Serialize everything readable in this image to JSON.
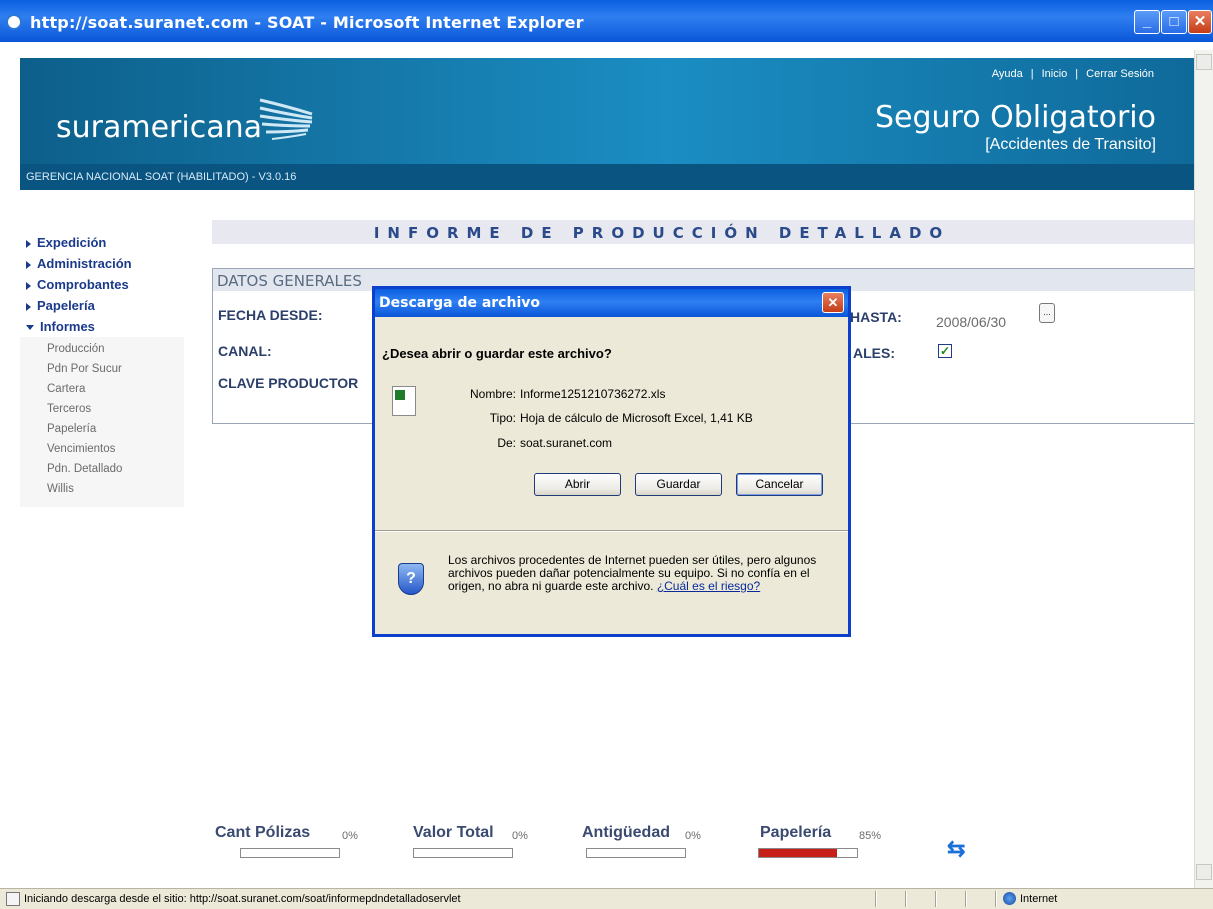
{
  "window": {
    "title": "http://soat.suranet.com - SOAT - Microsoft Internet Explorer"
  },
  "header": {
    "logo": "suramericana",
    "links": [
      "Ayuda",
      "Inicio",
      "Cerrar Sesión"
    ],
    "link_separator": "|",
    "brand_title": "Seguro Obligatorio",
    "brand_subtitle": "[Accidentes de Transito]",
    "subbar": "GERENCIA NACIONAL SOAT (HABILITADO) - V3.0.16"
  },
  "sidebar": {
    "items": [
      {
        "label": "Expedición"
      },
      {
        "label": "Administración"
      },
      {
        "label": "Comprobantes"
      },
      {
        "label": "Papelería"
      },
      {
        "label": "Informes"
      }
    ],
    "submenu": [
      "Producción",
      "Pdn Por Sucur",
      "Cartera",
      "Terceros",
      "Papelería",
      "Vencimientos",
      "Pdn. Detallado",
      "Willis"
    ]
  },
  "main": {
    "page_title": "INFORME DE PRODUCCIÓN DETALLADO",
    "section_title": "DATOS GENERALES",
    "fields": {
      "fecha_desde": "FECHA DESDE:",
      "canal": "CANAL:",
      "clave_productor": "CLAVE PRODUCTOR",
      "hasta_label": "HASTA:",
      "hasta_value": "2008/06/30",
      "totales_label": "ALES:",
      "calendar_button": "..."
    }
  },
  "dialog": {
    "title": "Descarga de archivo",
    "question": "¿Desea abrir o guardar este archivo?",
    "name_label": "Nombre:",
    "name_value": "Informe1251210736272.xls",
    "type_label": "Tipo:",
    "type_value": "Hoja de cálculo de Microsoft Excel, 1,41 KB",
    "from_label": "De:",
    "from_value": "soat.suranet.com",
    "buttons": {
      "open": "Abrir",
      "save": "Guardar",
      "cancel": "Cancelar"
    },
    "warning": "Los archivos procedentes de Internet pueden ser útiles, pero algunos archivos pueden dañar potencialmente su equipo. Si no confía en el origen, no abra ni guarde este archivo. ",
    "warning_link": "¿Cuál es el riesgo?"
  },
  "indicators": [
    {
      "label": "Cant Pólizas",
      "percent": "0%",
      "fill": 0
    },
    {
      "label": "Valor Total",
      "percent": "0%",
      "fill": 0
    },
    {
      "label": "Antigüedad",
      "percent": "0%",
      "fill": 0
    },
    {
      "label": "Papelería",
      "percent": "85%",
      "fill": 0.8
    }
  ],
  "statusbar": {
    "text": "Iniciando descarga desde el sitio: http://soat.suranet.com/soat/informepdndetalladoservlet",
    "zone": "Internet"
  },
  "colors": {
    "banner": "#1b8dc2",
    "subbar": "#0a5482",
    "nav_text": "#1a3a8a",
    "progress_fill": "#c72018"
  }
}
